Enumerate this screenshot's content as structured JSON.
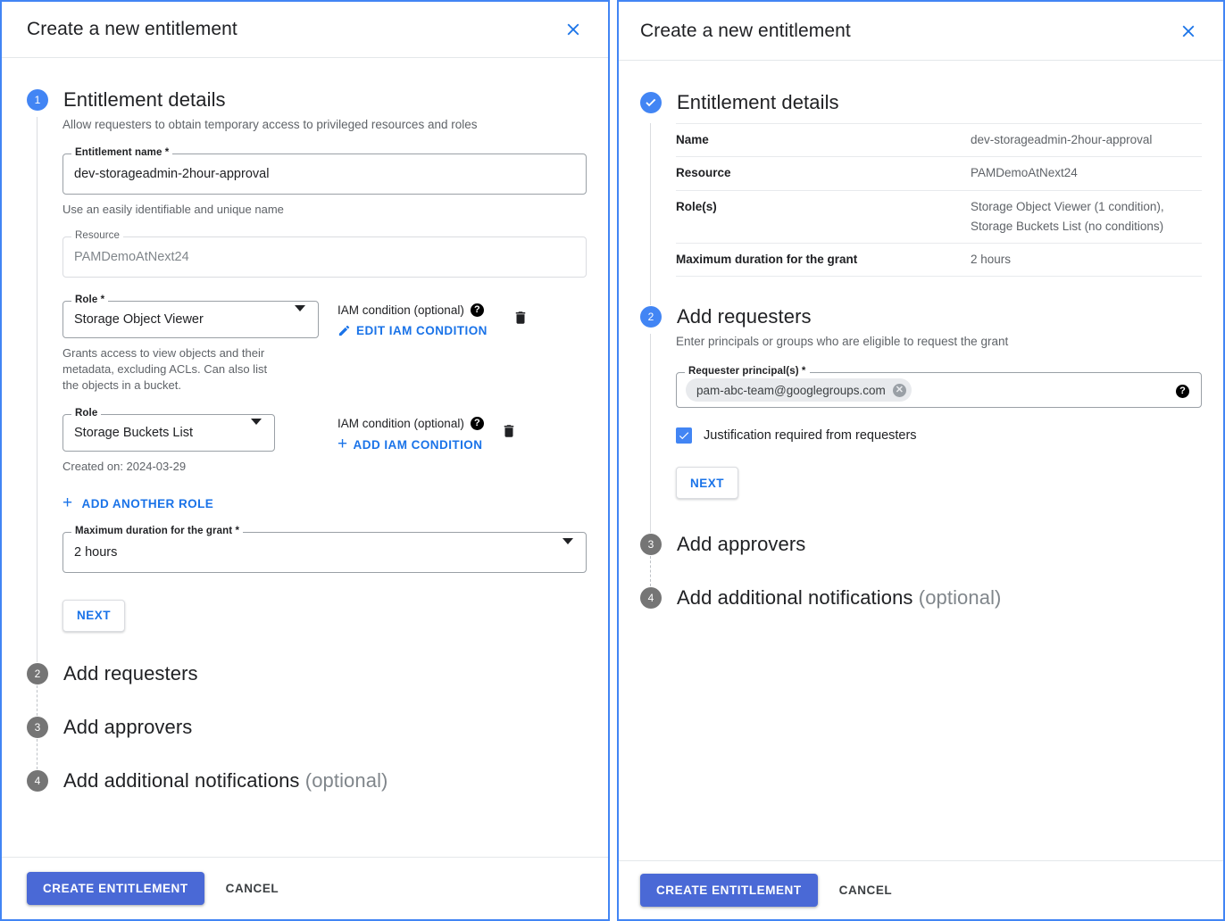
{
  "colors": {
    "accent_blue": "#4285f4",
    "link_blue": "#1a73e8",
    "primary_button": "#4a69d6",
    "step_inactive": "#757575",
    "muted_text": "#5f6368",
    "border": "#dadce0"
  },
  "left_panel": {
    "title": "Create a new entitlement",
    "close_label": "Close",
    "step1": {
      "badge": "1",
      "title": "Entitlement details",
      "description": "Allow requesters to obtain temporary access to privileged resources and roles",
      "entitlement_name": {
        "label": "Entitlement name *",
        "value": "dev-storageadmin-2hour-approval",
        "helper": "Use an easily identifiable and unique name"
      },
      "resource": {
        "label": "Resource",
        "value": "PAMDemoAtNext24"
      },
      "roles": [
        {
          "label": "Role *",
          "value": "Storage Object Viewer",
          "helper": "Grants access to view objects and their metadata, excluding ACLs. Can also list the objects in a bucket.",
          "condition_label": "IAM condition (optional)",
          "condition_action": "EDIT IAM CONDITION",
          "condition_action_icon": "pencil-icon",
          "delete_label": "Delete role"
        },
        {
          "label": "Role",
          "value": "Storage Buckets List",
          "helper": "Created on: 2024-03-29",
          "condition_label": "IAM condition (optional)",
          "condition_action": "ADD IAM CONDITION",
          "condition_action_icon": "plus-icon",
          "delete_label": "Delete role"
        }
      ],
      "add_another_role": "ADD ANOTHER ROLE",
      "max_duration": {
        "label": "Maximum duration for the grant *",
        "value": "2 hours"
      },
      "next_label": "NEXT"
    },
    "step2": {
      "badge": "2",
      "title": "Add requesters"
    },
    "step3": {
      "badge": "3",
      "title": "Add approvers"
    },
    "step4": {
      "badge": "4",
      "title": "Add additional notifications",
      "optional": "(optional)"
    },
    "footer": {
      "create_label": "CREATE ENTITLEMENT",
      "cancel_label": "CANCEL"
    }
  },
  "right_panel": {
    "title": "Create a new entitlement",
    "close_label": "Close",
    "step1": {
      "badge_icon": "check-circle-icon",
      "title": "Entitlement details",
      "summary_rows": [
        {
          "key": "Name",
          "value": "dev-storageadmin-2hour-approval"
        },
        {
          "key": "Resource",
          "value": "PAMDemoAtNext24"
        },
        {
          "key": "Role(s)",
          "value": "Storage Object Viewer (1 condition), Storage Buckets List (no conditions)"
        },
        {
          "key": "Maximum duration for the grant",
          "value": "2 hours"
        }
      ]
    },
    "step2": {
      "badge": "2",
      "title": "Add requesters",
      "description": "Enter principals or groups who are eligible to request the grant",
      "requester_field": {
        "label": "Requester principal(s) *",
        "chip": "pam-abc-team@googlegroups.com",
        "chip_remove_label": "Remove principal"
      },
      "justification": {
        "checked": true,
        "label": "Justification required from requesters"
      },
      "next_label": "NEXT"
    },
    "step3": {
      "badge": "3",
      "title": "Add approvers"
    },
    "step4": {
      "badge": "4",
      "title": "Add additional notifications",
      "optional": "(optional)"
    },
    "footer": {
      "create_label": "CREATE ENTITLEMENT",
      "cancel_label": "CANCEL"
    }
  }
}
